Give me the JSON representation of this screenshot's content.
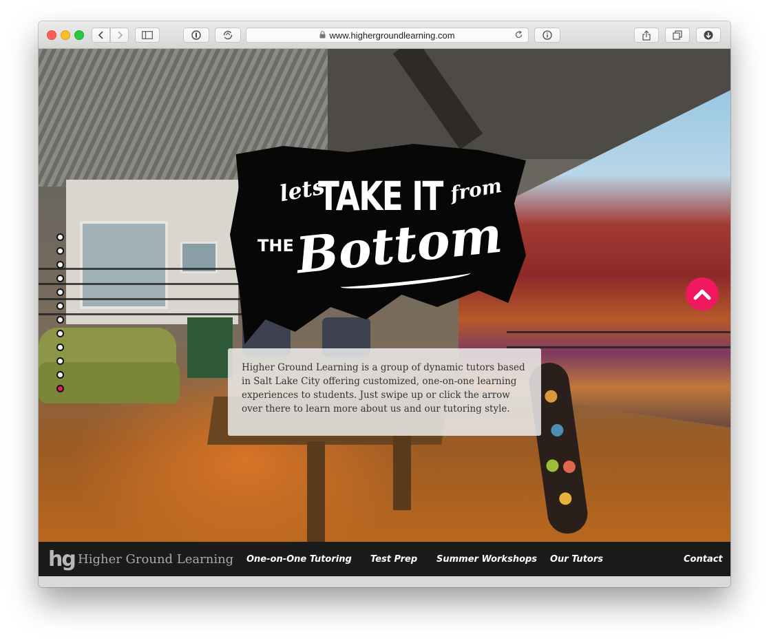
{
  "browser": {
    "url": "www.highergroundlearning.com"
  },
  "hero": {
    "line1_lets": "lets",
    "line1_main": "TAKE IT",
    "line1_from": "from",
    "line2_the": "THE",
    "line2_main": "Bottom",
    "intro": "Higher Ground Learning is a group of dynamic tutors based in Salt Lake City offering customized, one-on-one learning experiences to students. Just swipe up or click the arrow over there to learn more about us and our tutoring style."
  },
  "section_dots": {
    "count": 12,
    "active_index": 11
  },
  "navbar": {
    "logo_mark": "hg",
    "brand": "Higher Ground Learning",
    "links": [
      "One-on-One Tutoring",
      "Test Prep",
      "Summer Workshops",
      "Our Tutors"
    ],
    "contact": "Contact"
  },
  "colors": {
    "accent": "#f0185f",
    "navbar_bg": "#1b1b1b",
    "active_dot": "#e8185b"
  },
  "icons": [
    "back-icon",
    "forward-icon",
    "sidebar-icon",
    "password-icon",
    "sync-icon",
    "lock-icon",
    "reload-icon",
    "info-icon",
    "share-icon",
    "tabs-icon",
    "download-icon",
    "chevron-up-icon"
  ]
}
